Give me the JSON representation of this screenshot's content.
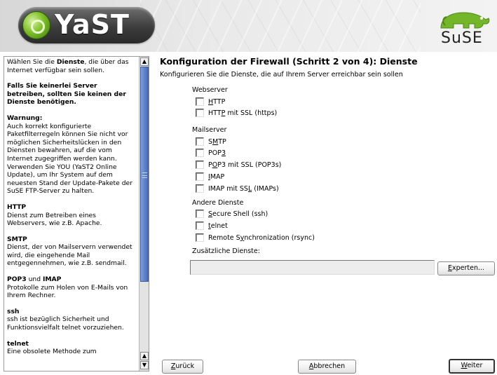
{
  "header": {
    "app_logo_text": "YaST",
    "brand_logo_text": "SuSE"
  },
  "help": {
    "paragraphs": [
      {
        "before": "Wählen Sie die ",
        "bold": "Dienste",
        "after": ", die über das Internet verfügbar sein sollen."
      },
      {
        "bold": "Falls Sie keinerlei Server betreiben, sollten Sie keinen der Dienste benötigen."
      },
      {
        "heading": "Warnung:",
        "text": "Auch korrekt konfigurierte Paketfilterregeln können Sie nicht vor möglichen Sicherheitslücken in den Diensten bewahren, auf die vom Internet zugegriffen werden kann. Verwenden Sie YOU (YaST2 Online Update), um Ihr System auf dem neuesten Stand der Update-Pakete der SuSE FTP-Server zu halten."
      },
      {
        "heading": "HTTP",
        "text": "Dienst zum Betreiben eines Webservers, wie z.B. Apache."
      },
      {
        "heading": "SMTP",
        "text": "Dienst, der von Mailservern verwendet wird, die eingehende Mail entgegennehmen, wie z.B. sendmail."
      },
      {
        "heading_a": "POP3",
        "heading_mid": " und ",
        "heading_b": "IMAP",
        "text": "Protokolle zum Holen von E-Mails von Ihrem Rechner."
      },
      {
        "heading": "ssh",
        "text": "ssh ist bezüglich Sicherheit und Funktionsvielfalt telnet vorzuziehen."
      },
      {
        "heading": "telnet",
        "text": "Eine obsolete Methode zum"
      }
    ],
    "scroll_up_glyph": "▲",
    "scroll_down_glyph": "▼"
  },
  "main": {
    "title": "Konfiguration der Firewall (Schritt 2 von 4): Dienste",
    "subtitle": "Konfigurieren Sie die Dienste, die auf Ihrem Server erreichbar sein sollen",
    "groups": [
      {
        "label": "Webserver",
        "items": [
          {
            "pre": "",
            "u": "H",
            "post": "TTP",
            "checked": false
          },
          {
            "pre": "HTT",
            "u": "P",
            "post": " mit SSL (https)",
            "checked": false
          }
        ]
      },
      {
        "label": "Mailserver",
        "items": [
          {
            "pre": "S",
            "u": "M",
            "post": "TP",
            "checked": false
          },
          {
            "pre": "POP",
            "u": "3",
            "post": "",
            "checked": false
          },
          {
            "pre": "P",
            "u": "O",
            "post": "P3 mit SSL (POP3s)",
            "checked": false
          },
          {
            "pre": "",
            "u": "I",
            "post": "MAP",
            "checked": false
          },
          {
            "pre": "IMAP mit SS",
            "u": "L",
            "post": " (IMAPs)",
            "checked": false
          }
        ]
      },
      {
        "label": "Andere Dienste",
        "items": [
          {
            "pre": "",
            "u": "S",
            "post": "ecure Shell (ssh)",
            "checked": false
          },
          {
            "pre": "",
            "u": "t",
            "post": "elnet",
            "checked": false
          },
          {
            "pre": "Remote S",
            "u": "y",
            "post": "nchronization (rsync)",
            "checked": false
          }
        ]
      }
    ],
    "additional_label": "Zusätzliche Dienste:",
    "additional_value": "",
    "experts_button": {
      "u": "E",
      "post": "xperten..."
    }
  },
  "footer": {
    "back_button": {
      "u": "Z",
      "post": "urück"
    },
    "cancel_button": {
      "u": "A",
      "post": "bbrechen"
    },
    "next_button": {
      "u": "W",
      "post": "eiter"
    }
  }
}
